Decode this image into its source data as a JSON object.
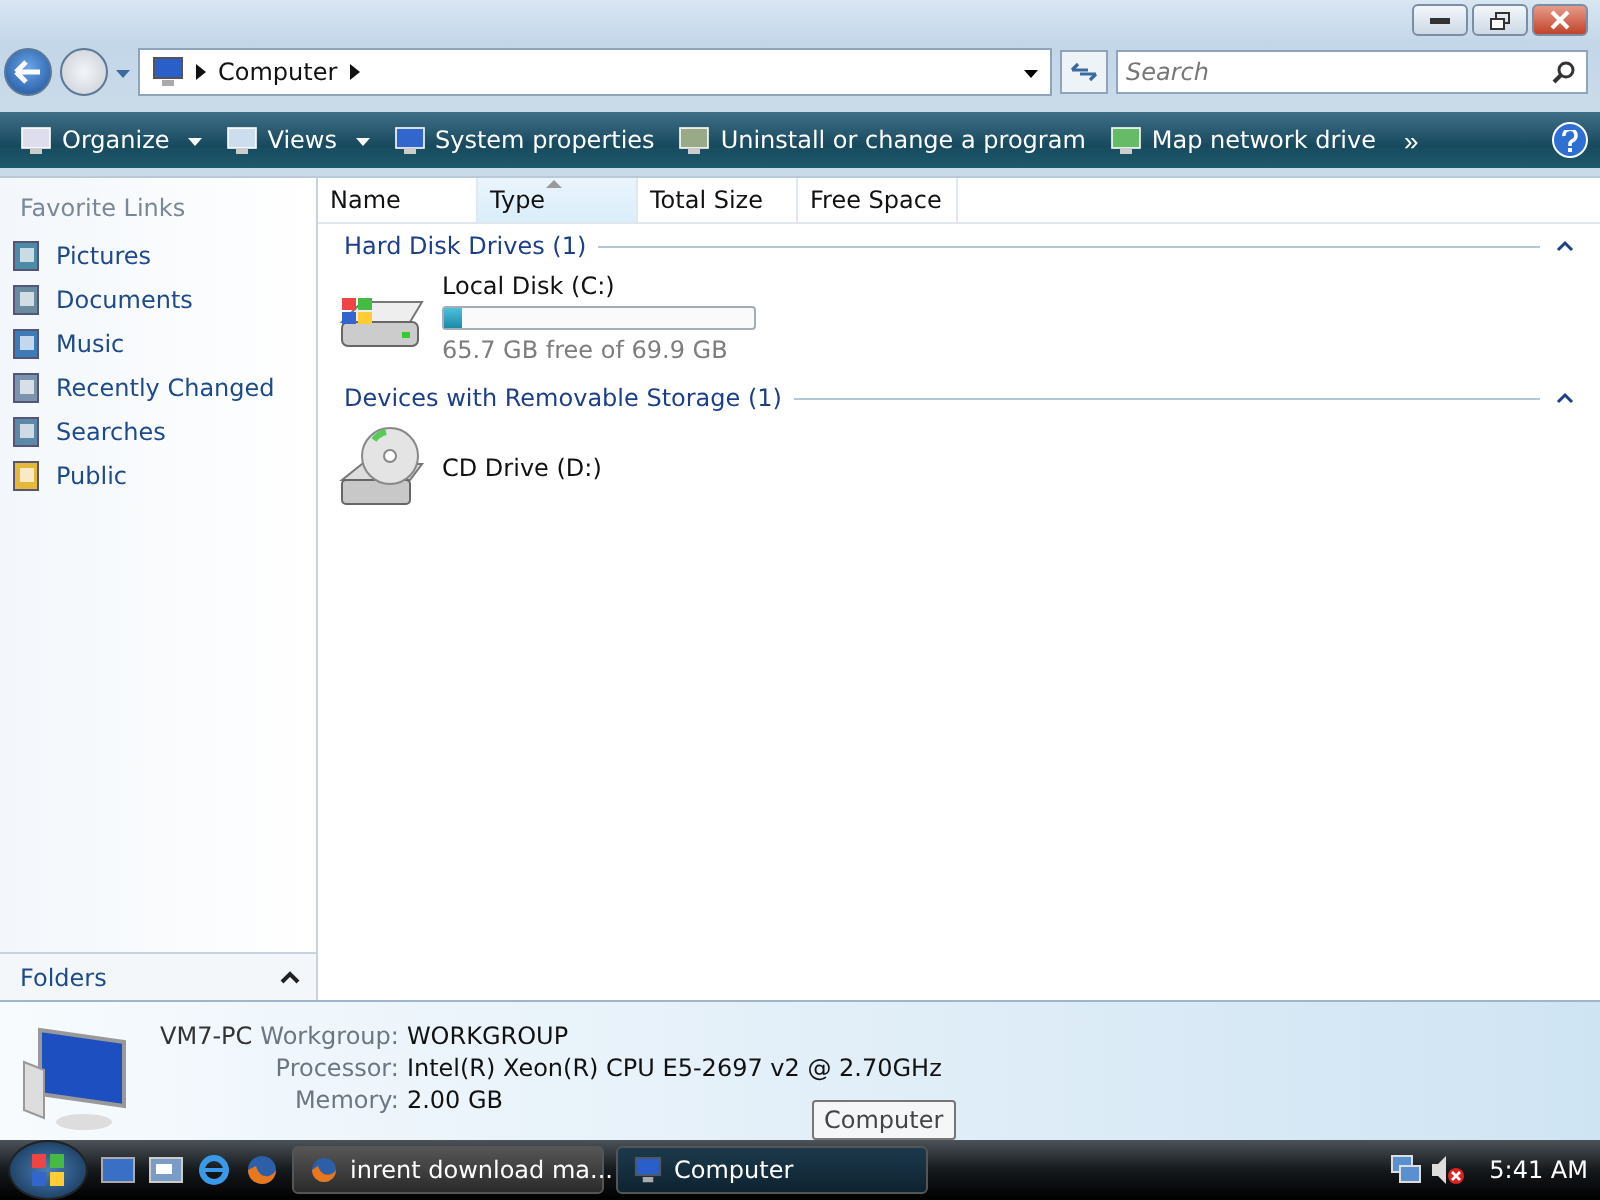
{
  "address_bar": {
    "path": [
      "Computer"
    ]
  },
  "search": {
    "placeholder": "Search"
  },
  "toolbar": {
    "items": [
      {
        "label": "Organize",
        "kind": "menu"
      },
      {
        "label": "Views",
        "kind": "menu"
      },
      {
        "label": "System properties",
        "kind": "plain"
      },
      {
        "label": "Uninstall or change a program",
        "kind": "plain"
      },
      {
        "label": "Map network drive",
        "kind": "plain"
      }
    ],
    "more": "»"
  },
  "sidebar": {
    "title": "Favorite Links",
    "items": [
      {
        "label": "Pictures"
      },
      {
        "label": "Documents"
      },
      {
        "label": "Music"
      },
      {
        "label": "Recently Changed"
      },
      {
        "label": "Searches"
      },
      {
        "label": "Public"
      }
    ],
    "folders": {
      "label": "Folders",
      "expanded": false
    }
  },
  "columns": [
    {
      "label": "Name",
      "sorted": false
    },
    {
      "label": "Type",
      "sorted": true
    },
    {
      "label": "Total Size",
      "sorted": false
    },
    {
      "label": "Free Space",
      "sorted": false
    }
  ],
  "groups": [
    {
      "title": "Hard Disk Drives (1)",
      "expanded": true,
      "items": [
        {
          "kind": "disk",
          "name": "Local Disk (C:)",
          "level": 0.06,
          "free": "65.7 GB free of 69.9 GB"
        }
      ]
    },
    {
      "title": "Devices with Removable Storage (1)",
      "expanded": true,
      "items": [
        {
          "kind": "cd",
          "name": "CD Drive (D:)"
        }
      ]
    }
  ],
  "details": {
    "name": "VM7-PC",
    "fields": [
      {
        "label": "Workgroup:",
        "value": "WORKGROUP"
      },
      {
        "label": "Processor:",
        "value": "Intel(R) Xeon(R) CPU E5-2697 v2 @ 2.70GHz"
      },
      {
        "label": "Memory:",
        "value": "2.00 GB"
      }
    ]
  },
  "tooltip": "Computer",
  "taskbar": {
    "buttons": [
      {
        "label": "inrent download ma...",
        "selected": false,
        "kind": "firefox"
      },
      {
        "label": "Computer",
        "selected": true,
        "kind": "computer"
      }
    ],
    "clock": "5:41 AM"
  }
}
